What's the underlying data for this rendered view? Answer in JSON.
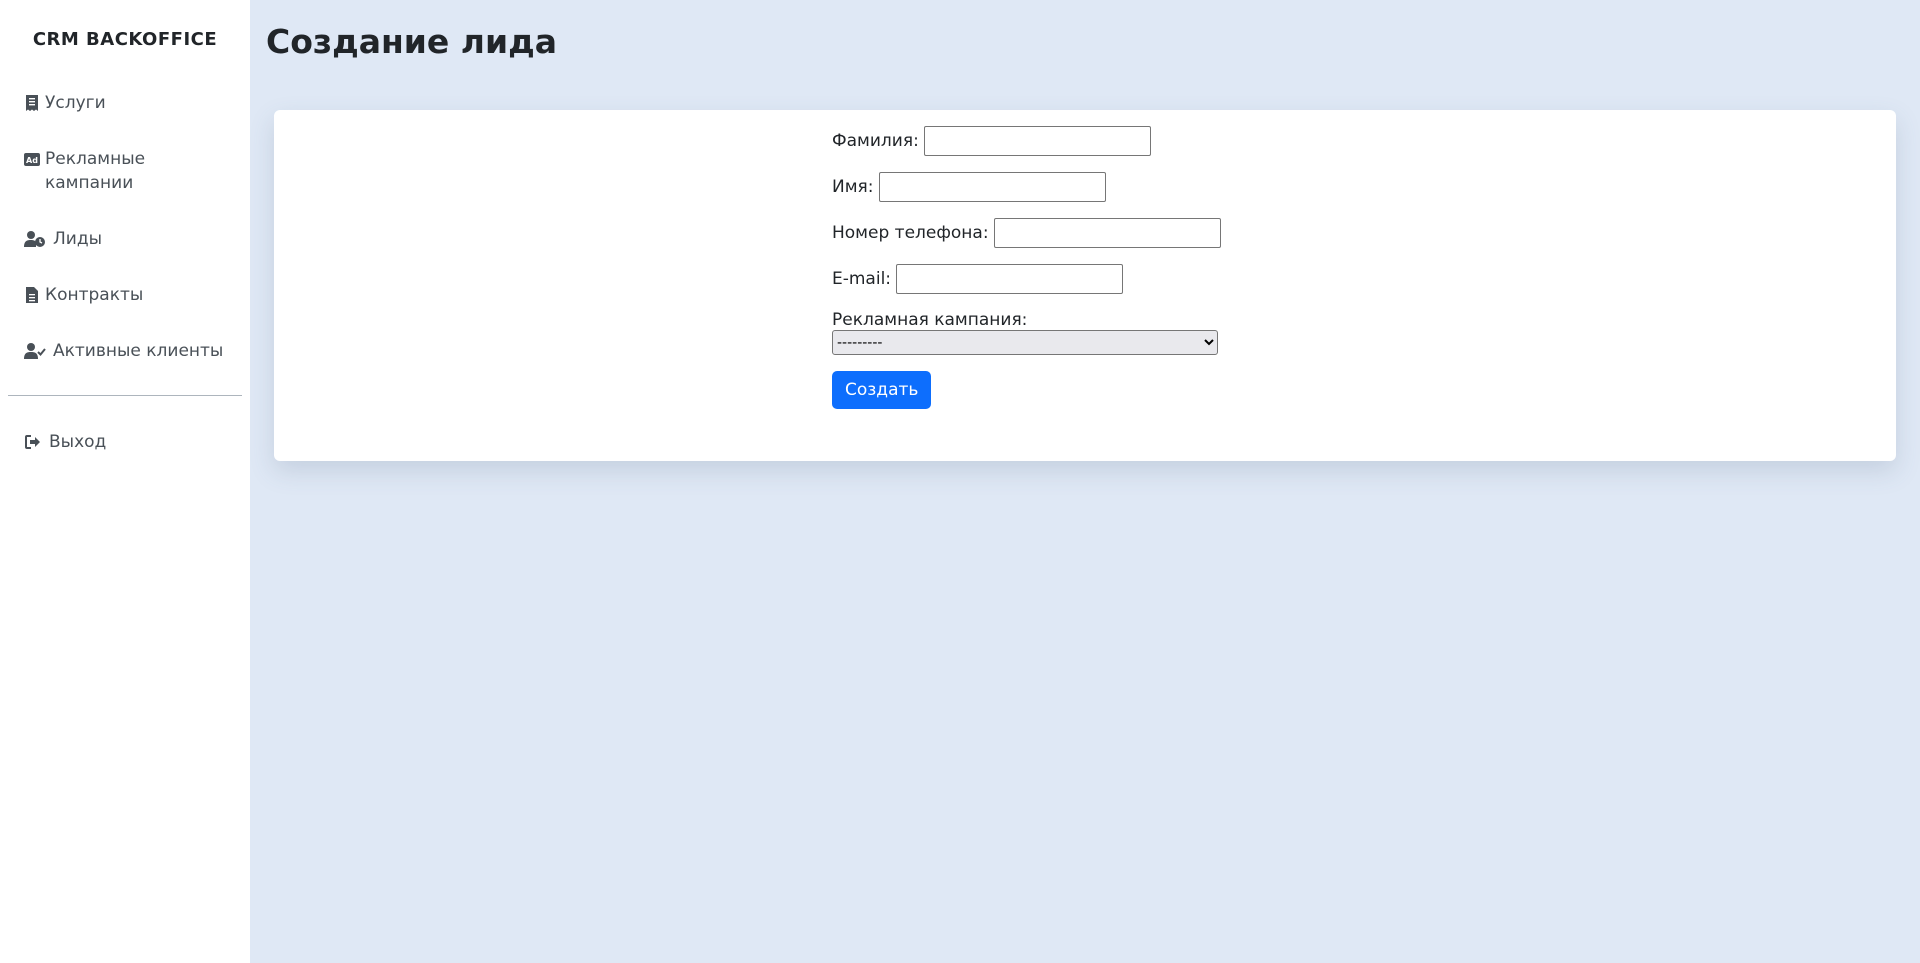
{
  "sidebar": {
    "brand": "CRM BACKOFFICE",
    "items": [
      {
        "label": "Услуги",
        "icon": "receipt-icon"
      },
      {
        "label": "Рекламные кампании",
        "icon": "ad-icon"
      },
      {
        "label": "Лиды",
        "icon": "user-clock-icon"
      },
      {
        "label": "Контракты",
        "icon": "file-icon"
      },
      {
        "label": "Активные клиенты",
        "icon": "user-check-icon"
      }
    ],
    "logout": {
      "label": "Выход",
      "icon": "sign-out-icon"
    }
  },
  "main": {
    "title": "Создание лида",
    "form": {
      "last_name_label": "Фамилия:",
      "last_name_value": "",
      "first_name_label": "Имя:",
      "first_name_value": "",
      "phone_label": "Номер телефона:",
      "phone_value": "",
      "email_label": "E-mail:",
      "email_value": "",
      "campaign_label": "Рекламная кампания:",
      "campaign_selected": "---------",
      "submit_label": "Создать"
    }
  },
  "colors": {
    "accent": "#0d6efd",
    "background": "#dfe8f5",
    "sidebar": "#ffffff"
  }
}
